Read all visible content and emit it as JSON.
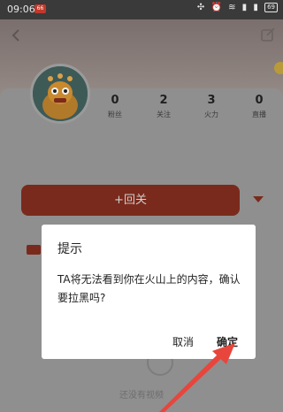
{
  "status_bar": {
    "time": "09:06",
    "notification_badge": "66",
    "battery": "69",
    "icons": [
      "nfc-icon",
      "alarm-icon",
      "wifi-icon",
      "signal-icon",
      "signal-icon"
    ]
  },
  "profile": {
    "stats": [
      {
        "value": "0",
        "label": "粉丝"
      },
      {
        "value": "2",
        "label": "关注"
      },
      {
        "value": "3",
        "label": "火力"
      },
      {
        "value": "0",
        "label": "直播"
      }
    ],
    "follow_back_label": "+回关",
    "empty_text": "还没有视频"
  },
  "dialog": {
    "title": "提示",
    "message": "TA将无法看到你在火山上的内容，确认要拉黑吗?",
    "cancel_label": "取消",
    "confirm_label": "确定"
  },
  "colors": {
    "accent": "#7a2a1c",
    "annotation_arrow": "#e8453c",
    "dialog_bg": "#ffffff"
  }
}
